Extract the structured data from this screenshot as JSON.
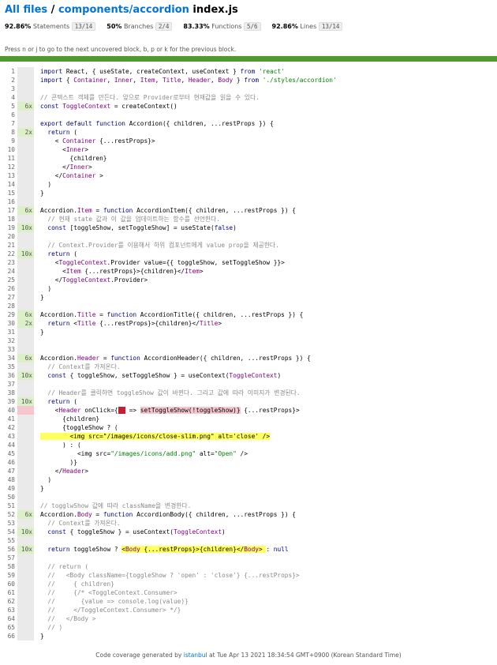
{
  "header": {
    "all_files": "All files",
    "sep": " / ",
    "dir": "components/accordion",
    "file": "index.js"
  },
  "stats": [
    {
      "pct": "92.86%",
      "label": "Statements",
      "frac": "13/14"
    },
    {
      "pct": "50%",
      "label": "Branches",
      "frac": "2/4"
    },
    {
      "pct": "83.33%",
      "label": "Functions",
      "frac": "5/6"
    },
    {
      "pct": "92.86%",
      "label": "Lines",
      "frac": "13/14"
    }
  ],
  "hint": "Press n or j to go to the next uncovered block, b, p or k for the previous block.",
  "lines": [
    {
      "n": "1",
      "hit": "",
      "src": "import React, { useState, createContext, useContext } from 'react'"
    },
    {
      "n": "2",
      "hit": "",
      "src": "import { Container, Inner, Item, Title, Header, Body } from './styles/accordion'"
    },
    {
      "n": "3",
      "hit": "",
      "src": ""
    },
    {
      "n": "4",
      "hit": "",
      "src": "// 콘텍스트 객체를 만든다. 앞으로 Provider로부터 현재값을 읽을 수 있다."
    },
    {
      "n": "5",
      "hit": "6x",
      "src": "const ToggleContext = createContext()"
    },
    {
      "n": "6",
      "hit": "",
      "src": ""
    },
    {
      "n": "7",
      "hit": "",
      "src": "export default function Accordion({ children, ...restProps }) {"
    },
    {
      "n": "8",
      "hit": "2x",
      "src": "  return ("
    },
    {
      "n": "9",
      "hit": "",
      "src": "    < Container {...restProps}>"
    },
    {
      "n": "10",
      "hit": "",
      "src": "      <Inner>"
    },
    {
      "n": "11",
      "hit": "",
      "src": "        {children}"
    },
    {
      "n": "12",
      "hit": "",
      "src": "      </Inner>"
    },
    {
      "n": "13",
      "hit": "",
      "src": "    </Container >"
    },
    {
      "n": "14",
      "hit": "",
      "src": "  )"
    },
    {
      "n": "15",
      "hit": "",
      "src": "}"
    },
    {
      "n": "16",
      "hit": "",
      "src": ""
    },
    {
      "n": "17",
      "hit": "6x",
      "src": "Accordion.Item = function AccordionItem({ children, ...restProps }) {"
    },
    {
      "n": "18",
      "hit": "",
      "src": "  // 현재 state 값과 이 값을 업데이트하는 함수를 선언한다."
    },
    {
      "n": "19",
      "hit": "10x",
      "src": "  const [toggleShow, setToggleShow] = useState(false)"
    },
    {
      "n": "20",
      "hit": "",
      "src": ""
    },
    {
      "n": "21",
      "hit": "",
      "src": "  // Context.Provider를 이용해서 하위 컴포넌트에게 value prop을 제공한다."
    },
    {
      "n": "22",
      "hit": "10x",
      "src": "  return ("
    },
    {
      "n": "23",
      "hit": "",
      "src": "    <ToggleContext.Provider value={{ toggleShow, setToggleShow }}>"
    },
    {
      "n": "24",
      "hit": "",
      "src": "      <Item {...restProps}>{children}</Item>"
    },
    {
      "n": "25",
      "hit": "",
      "src": "    </ToggleContext.Provider>"
    },
    {
      "n": "26",
      "hit": "",
      "src": "  )"
    },
    {
      "n": "27",
      "hit": "",
      "src": "}"
    },
    {
      "n": "28",
      "hit": "",
      "src": ""
    },
    {
      "n": "29",
      "hit": "6x",
      "src": "Accordion.Title = function AccordionTitle({ children, ...restProps }) {"
    },
    {
      "n": "30",
      "hit": "2x",
      "src": "  return <Title {...restProps}>{children}</Title>"
    },
    {
      "n": "31",
      "hit": "",
      "src": "}"
    },
    {
      "n": "32",
      "hit": "",
      "src": ""
    },
    {
      "n": "33",
      "hit": "",
      "src": ""
    },
    {
      "n": "34",
      "hit": "6x",
      "src": "Accordion.Header = function AccordionHeader({ children, ...restProps }) {"
    },
    {
      "n": "35",
      "hit": "",
      "src": "  // Context를 가져온다."
    },
    {
      "n": "36",
      "hit": "10x",
      "src": "  const { toggleShow, setToggleShow } = useContext(ToggleContext)"
    },
    {
      "n": "37",
      "hit": "",
      "src": ""
    },
    {
      "n": "38",
      "hit": "",
      "src": "  // Header를 클릭하면 toggleShow 값이 바뀐다. 그리고 값에 따라 이미지가 변경된다."
    },
    {
      "n": "39",
      "hit": "10x",
      "src": "  return ("
    },
    {
      "n": "40",
      "hit": "",
      "src": "    <Header onClick={() => setToggleShow(!toggleShow)} {...restProps}>"
    },
    {
      "n": "41",
      "hit": "",
      "src": "      {children}"
    },
    {
      "n": "42",
      "hit": "",
      "src": "      {toggleShow ? ("
    },
    {
      "n": "43",
      "hit": "",
      "src": "        <img src=\"/images/icons/close-slim.png\" alt='close' />"
    },
    {
      "n": "44",
      "hit": "",
      "src": "      ) : ("
    },
    {
      "n": "45",
      "hit": "",
      "src": "          <img src=\"/images/icons/add.png\" alt=\"Open\" />"
    },
    {
      "n": "46",
      "hit": "",
      "src": "        )}"
    },
    {
      "n": "47",
      "hit": "",
      "src": "    </Header>"
    },
    {
      "n": "48",
      "hit": "",
      "src": "  )"
    },
    {
      "n": "49",
      "hit": "",
      "src": "}"
    },
    {
      "n": "50",
      "hit": "",
      "src": ""
    },
    {
      "n": "51",
      "hit": "",
      "src": "// togglwShow 값에 따라 className을 변경한다."
    },
    {
      "n": "52",
      "hit": "6x",
      "src": "Accordion.Body = function AccordionBody({ children, ...restProps }) {"
    },
    {
      "n": "53",
      "hit": "",
      "src": "  // Context를 가져온다."
    },
    {
      "n": "54",
      "hit": "10x",
      "src": "  const { toggleShow } = useContext(ToggleContext)"
    },
    {
      "n": "55",
      "hit": "",
      "src": ""
    },
    {
      "n": "56",
      "hit": "10x",
      "src": "  return toggleShow ? <Body {...restProps}>{children}</Body> : null"
    },
    {
      "n": "57",
      "hit": "",
      "src": ""
    },
    {
      "n": "58",
      "hit": "",
      "src": "  // return ("
    },
    {
      "n": "59",
      "hit": "",
      "src": "  //   <Body className={toggleShow ? 'open' : 'close'} {...restProps}>"
    },
    {
      "n": "60",
      "hit": "",
      "src": "  //     { children}"
    },
    {
      "n": "61",
      "hit": "",
      "src": "  //     {/* <ToggleContext.Consumer>"
    },
    {
      "n": "62",
      "hit": "",
      "src": "  //       {value => console.log(value)}"
    },
    {
      "n": "63",
      "hit": "",
      "src": "  //     </ToggleContext.Consumer> */}"
    },
    {
      "n": "64",
      "hit": "",
      "src": "  //   </Body >"
    },
    {
      "n": "65",
      "hit": "",
      "src": "  // )"
    },
    {
      "n": "66",
      "hit": "",
      "src": "}"
    }
  ],
  "footer": {
    "prefix": "Code coverage generated by ",
    "tool": "istanbul",
    "suffix": " at Tue Apr 13 2021 18:34:54 GMT+0900 (Korean Standard Time)"
  }
}
